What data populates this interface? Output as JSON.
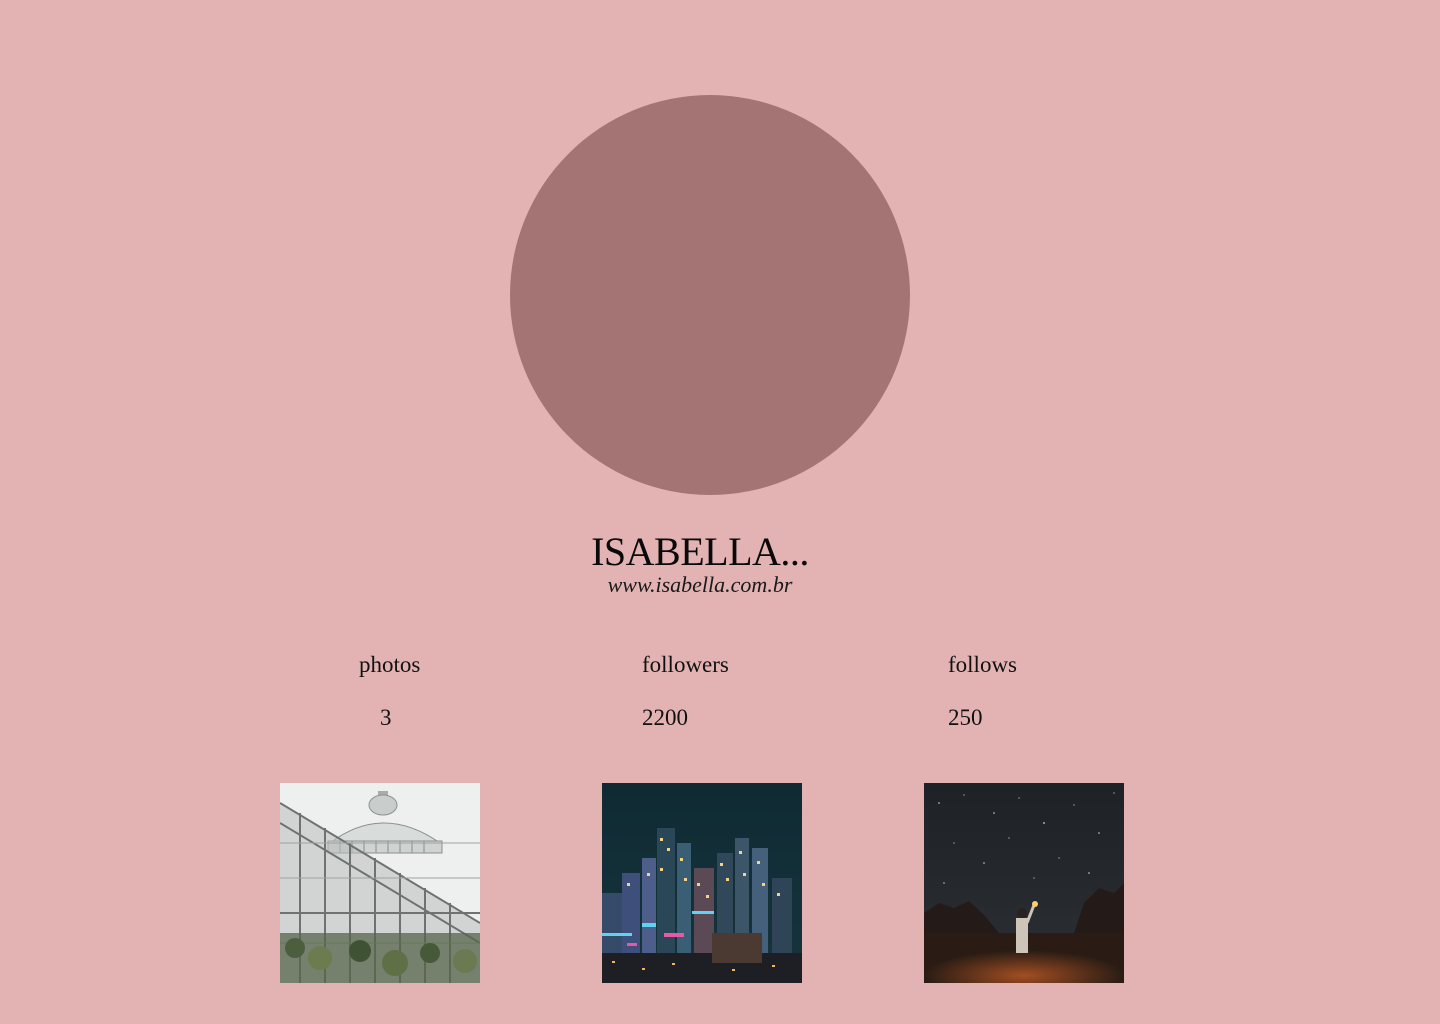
{
  "profile": {
    "name": "ISABELLA...",
    "website": "www.isabella.com.br",
    "avatar_color": "#a37473"
  },
  "stats": {
    "photos_label": "photos",
    "photos_value": "3",
    "followers_label": "followers",
    "followers_value": "2200",
    "follows_label": "follows",
    "follows_value": "250"
  },
  "gallery": {
    "items": [
      {
        "subject": "greenhouse-dome"
      },
      {
        "subject": "city-skyline-night"
      },
      {
        "subject": "starry-night-desert"
      }
    ]
  },
  "colors": {
    "background": "#e3b3b4",
    "text": "#111111"
  }
}
